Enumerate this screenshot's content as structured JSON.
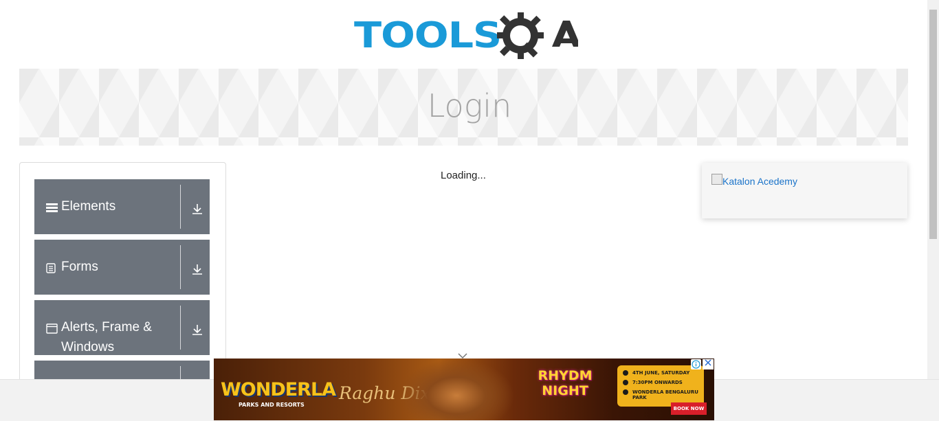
{
  "logo": {
    "text_tools": "TOOLS",
    "text_qa": "A"
  },
  "banner": {
    "title": "Login"
  },
  "sidebar": {
    "groups": [
      {
        "label": "Elements",
        "icon": "menu-bars-icon"
      },
      {
        "label": "Forms",
        "icon": "document-icon"
      },
      {
        "label": "Alerts, Frame & Windows",
        "icon": "window-icon"
      }
    ]
  },
  "main": {
    "loading_text": "Loading..."
  },
  "ad_card": {
    "link_text": "Katalon Acedemy"
  },
  "ad_banner": {
    "brand": "WONDERLA",
    "brand_sub": "PARKS AND RESORTS",
    "artist": "Raghu Dixit",
    "event": "RHYDM NIGHT",
    "date": "4TH JUNE, SATURDAY",
    "time": "7:30PM ONWARDS",
    "venue": "WONDERLA BENGALURU PARK",
    "cta": "BOOK NOW"
  },
  "colors": {
    "brand_blue": "#1a9ad8",
    "brand_dark": "#333333",
    "sidebar_group": "#6c737c",
    "link": "#1a73c9"
  }
}
